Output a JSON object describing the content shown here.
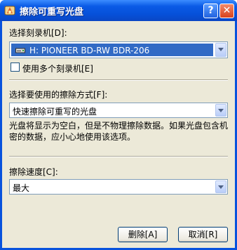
{
  "window": {
    "title": "擦除可重写光盘",
    "help_button": "?",
    "close_button": "✕"
  },
  "recorder": {
    "label": "选择刻录机[D]:",
    "selected": "H: PIONEER BD-RW   BDR-206",
    "multi_checkbox_label": "使用多个刻录机[E]",
    "multi_checked": false
  },
  "erase_method": {
    "label": "选择要使用的擦除方式[F]:",
    "selected": "快速擦除可重写的光盘",
    "description": "光盘将显示为空白，但是不物理擦除数据。如果光盘包含机密的数据，应小心地使用该选项。"
  },
  "erase_speed": {
    "label": "擦除速度[C]:",
    "selected": "最大"
  },
  "buttons": {
    "erase": "删除[A]",
    "cancel": "取消[R]"
  },
  "colors": {
    "titlebar": "#0a5ae6",
    "face": "#ece9d8",
    "selection": "#316ac5"
  },
  "icons": {
    "app": "burn-app-icon",
    "drive": "optical-drive-icon"
  }
}
